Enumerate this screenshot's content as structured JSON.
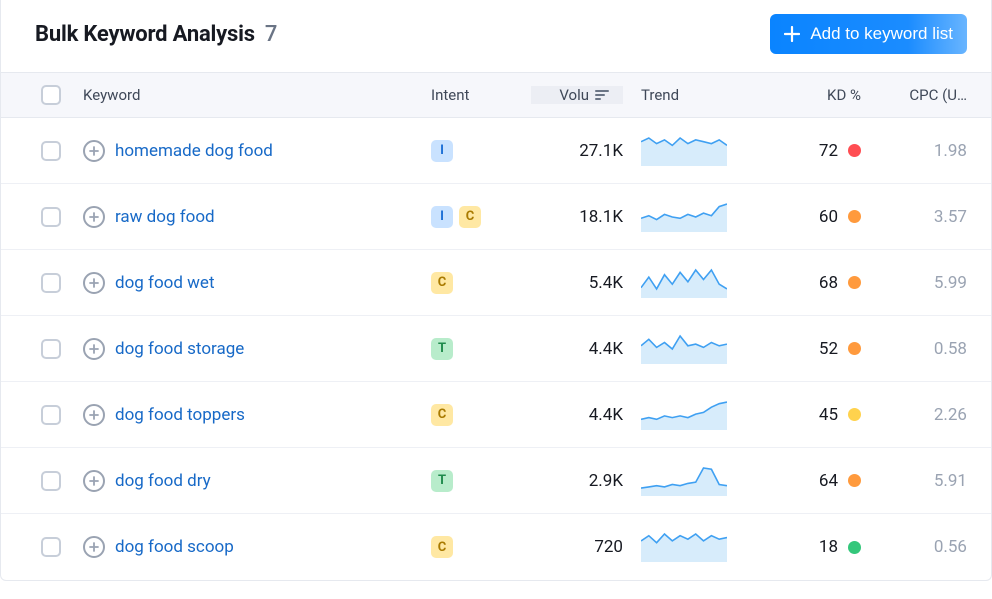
{
  "header": {
    "title": "Bulk Keyword Analysis",
    "count": "7",
    "add_button_label": "Add to keyword list"
  },
  "columns": {
    "keyword": "Keyword",
    "intent": "Intent",
    "volume": "Volu",
    "trend": "Trend",
    "kd": "KD %",
    "cpc": "CPC (U…"
  },
  "intent_colors": {
    "I": "intent-I",
    "C": "intent-C",
    "T": "intent-T",
    "N": "intent-N"
  },
  "kd_colors": {
    "red": "kd-red",
    "orange": "kd-orange",
    "yellow": "kd-yellow",
    "green": "kd-green"
  },
  "rows": [
    {
      "keyword": "homemade dog food",
      "intents": [
        "I"
      ],
      "volume": "27.1K",
      "trend": [
        12,
        14,
        11,
        13,
        10,
        14,
        11,
        13,
        12,
        11,
        13,
        10
      ],
      "kd": "72",
      "kd_color": "red",
      "cpc": "1.98"
    },
    {
      "keyword": "raw dog food",
      "intents": [
        "I",
        "C"
      ],
      "volume": "18.1K",
      "trend": [
        9,
        11,
        8,
        12,
        10,
        9,
        12,
        10,
        13,
        11,
        18,
        20
      ],
      "kd": "60",
      "kd_color": "orange",
      "cpc": "3.57"
    },
    {
      "keyword": "dog food wet",
      "intents": [
        "C"
      ],
      "volume": "5.4K",
      "trend": [
        7,
        16,
        6,
        18,
        10,
        20,
        12,
        22,
        14,
        22,
        10,
        6
      ],
      "kd": "68",
      "kd_color": "orange",
      "cpc": "5.99"
    },
    {
      "keyword": "dog food storage",
      "intents": [
        "T"
      ],
      "volume": "4.4K",
      "trend": [
        10,
        14,
        9,
        12,
        8,
        16,
        10,
        11,
        9,
        12,
        10,
        11
      ],
      "kd": "52",
      "kd_color": "orange",
      "cpc": "0.58"
    },
    {
      "keyword": "dog food toppers",
      "intents": [
        "C"
      ],
      "volume": "4.4K",
      "trend": [
        5,
        6,
        5,
        7,
        6,
        7,
        6,
        8,
        9,
        12,
        14,
        15
      ],
      "kd": "45",
      "kd_color": "yellow",
      "cpc": "2.26"
    },
    {
      "keyword": "dog food dry",
      "intents": [
        "T"
      ],
      "volume": "2.9K",
      "trend": [
        5,
        6,
        7,
        6,
        8,
        7,
        9,
        10,
        22,
        21,
        8,
        7
      ],
      "kd": "64",
      "kd_color": "orange",
      "cpc": "5.91"
    },
    {
      "keyword": "dog food scoop",
      "intents": [
        "C"
      ],
      "volume": "720",
      "trend": [
        11,
        14,
        10,
        15,
        11,
        14,
        12,
        15,
        11,
        14,
        12,
        13
      ],
      "kd": "18",
      "kd_color": "green",
      "cpc": "0.56"
    }
  ]
}
